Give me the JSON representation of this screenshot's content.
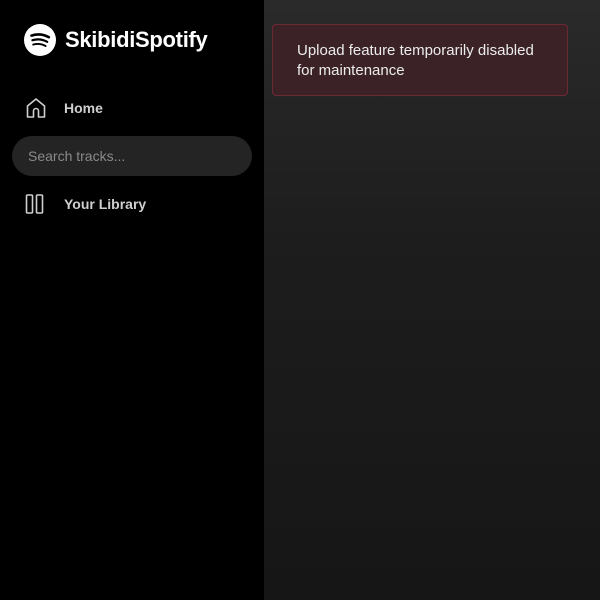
{
  "app": {
    "name": "SkibidiSpotify",
    "logo_icon": "spotify-logo-icon",
    "accent_color": "#ffffff"
  },
  "sidebar": {
    "nav": [
      {
        "label": "Home",
        "icon": "home-icon"
      },
      {
        "label": "Your Library",
        "icon": "library-icon"
      }
    ],
    "search": {
      "placeholder": "Search tracks...",
      "value": ""
    }
  },
  "main": {
    "alert": {
      "message": "Upload feature temporarily disabled for maintenance",
      "border_color": "#6b2a32",
      "background_color": "#3a2226"
    }
  }
}
